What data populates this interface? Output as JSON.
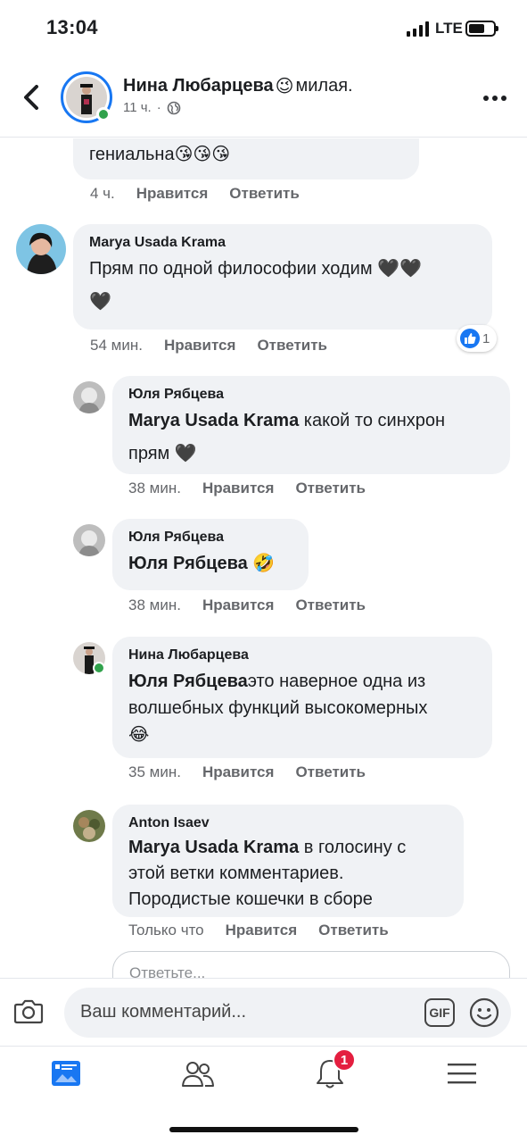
{
  "status_bar": {
    "time": "13:04",
    "network": "LTE"
  },
  "post": {
    "author": "Нина Любарцева",
    "feeling_emoji": "😉",
    "feeling": "милая.",
    "time": "11 ч.",
    "separator": "·"
  },
  "comments": [
    {
      "id": "partial",
      "text": "гениальна",
      "emojis": "😘😘😘",
      "time": "4 ч.",
      "like": "Нравится",
      "reply": "Ответить"
    },
    {
      "id": "marya",
      "author": "Marya Usada Krama",
      "text_line1": "Прям по одной философии ходим 🖤🖤",
      "text_line2": "🖤",
      "time": "54 мин.",
      "like": "Нравится",
      "reply": "Ответить",
      "reaction_count": "1"
    },
    {
      "id": "yulia1",
      "author": "Юля Рябцева",
      "mention": "Marya Usada Krama",
      "text_line1": " какой то синхрон",
      "text_line2": "прям 🖤",
      "time": "38 мин.",
      "like": "Нравится",
      "reply": "Ответить"
    },
    {
      "id": "yulia2",
      "author": "Юля Рябцева",
      "mention": "Юля Рябцева",
      "text": " 🤣",
      "time": "38 мин.",
      "like": "Нравится",
      "reply": "Ответить"
    },
    {
      "id": "nina",
      "author": "Нина Любарцева",
      "mention": "Юля Рябцева",
      "text_line1": "это наверное одна из",
      "text_line2": "волшебных функций высокомерных",
      "text_line3": "😂",
      "time": "35 мин.",
      "like": "Нравится",
      "reply": "Ответить"
    },
    {
      "id": "anton",
      "author": "Anton Isaev",
      "mention": "Marya Usada Krama",
      "text_line1": " в голосину с",
      "text_line2": "этой ветки комментариев.",
      "text_line3": "Породистые кошечки в сборе",
      "time": "Только что",
      "like": "Нравится",
      "reply": "Ответить"
    }
  ],
  "reply_placeholder": "Ответьте...",
  "composer": {
    "placeholder": "Ваш комментарий...",
    "gif": "GIF"
  },
  "tabs": {
    "items": [
      "feed-icon",
      "friends-icon",
      "notifications-icon",
      "menu-icon"
    ],
    "notifications_badge": "1"
  },
  "colors": {
    "accent": "#1877f2",
    "online": "#31a24c",
    "badge": "#e41e3f",
    "bubble": "#f0f2f5"
  }
}
